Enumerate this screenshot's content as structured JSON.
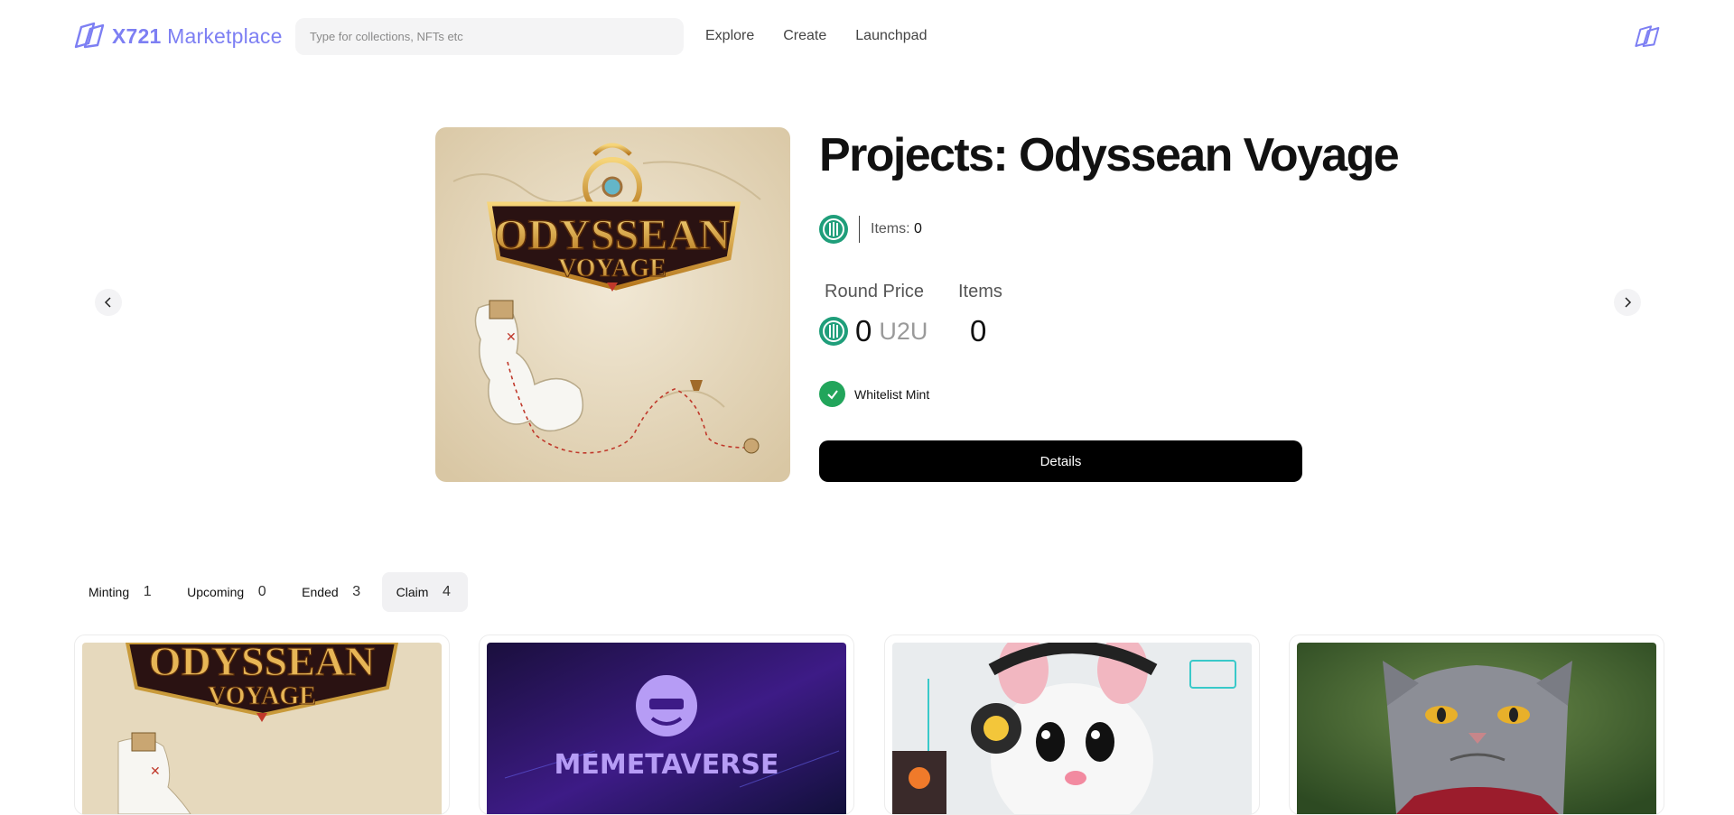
{
  "header": {
    "logo_bold": "X721",
    "logo_light": "Marketplace",
    "search_placeholder": "Type for collections, NFTs etc",
    "nav": [
      "Explore",
      "Create",
      "Launchpad"
    ]
  },
  "hero": {
    "title": "Projects: Odyssean Voyage",
    "items_label": "Items:",
    "items_count": "0",
    "round_price_label": "Round Price",
    "items_stat_label": "Items",
    "price_value": "0",
    "price_unit": "U2U",
    "items_value": "0",
    "round_name": "Whitelist Mint",
    "details_label": "Details",
    "image_text_line1": "ODYSSEAN",
    "image_text_line2": "VOYAGE"
  },
  "tabs": [
    {
      "label": "Minting",
      "count": "1"
    },
    {
      "label": "Upcoming",
      "count": "0"
    },
    {
      "label": "Ended",
      "count": "3"
    },
    {
      "label": "Claim",
      "count": "4"
    }
  ],
  "cards": [
    {
      "image_text_line1": "ODYSSEAN",
      "image_text_line2": "VOYAGE"
    },
    {
      "image_text": "MEMETAVERSE"
    },
    {},
    {}
  ],
  "colors": {
    "brand": "#7d7ff3",
    "chain_green": "#1f9e7a",
    "check_green": "#22a55b",
    "button_black": "#000000"
  },
  "icons": [
    "x721-logo-icon",
    "chevron-left-icon",
    "chevron-right-icon",
    "u2u-chain-icon",
    "check-icon"
  ]
}
